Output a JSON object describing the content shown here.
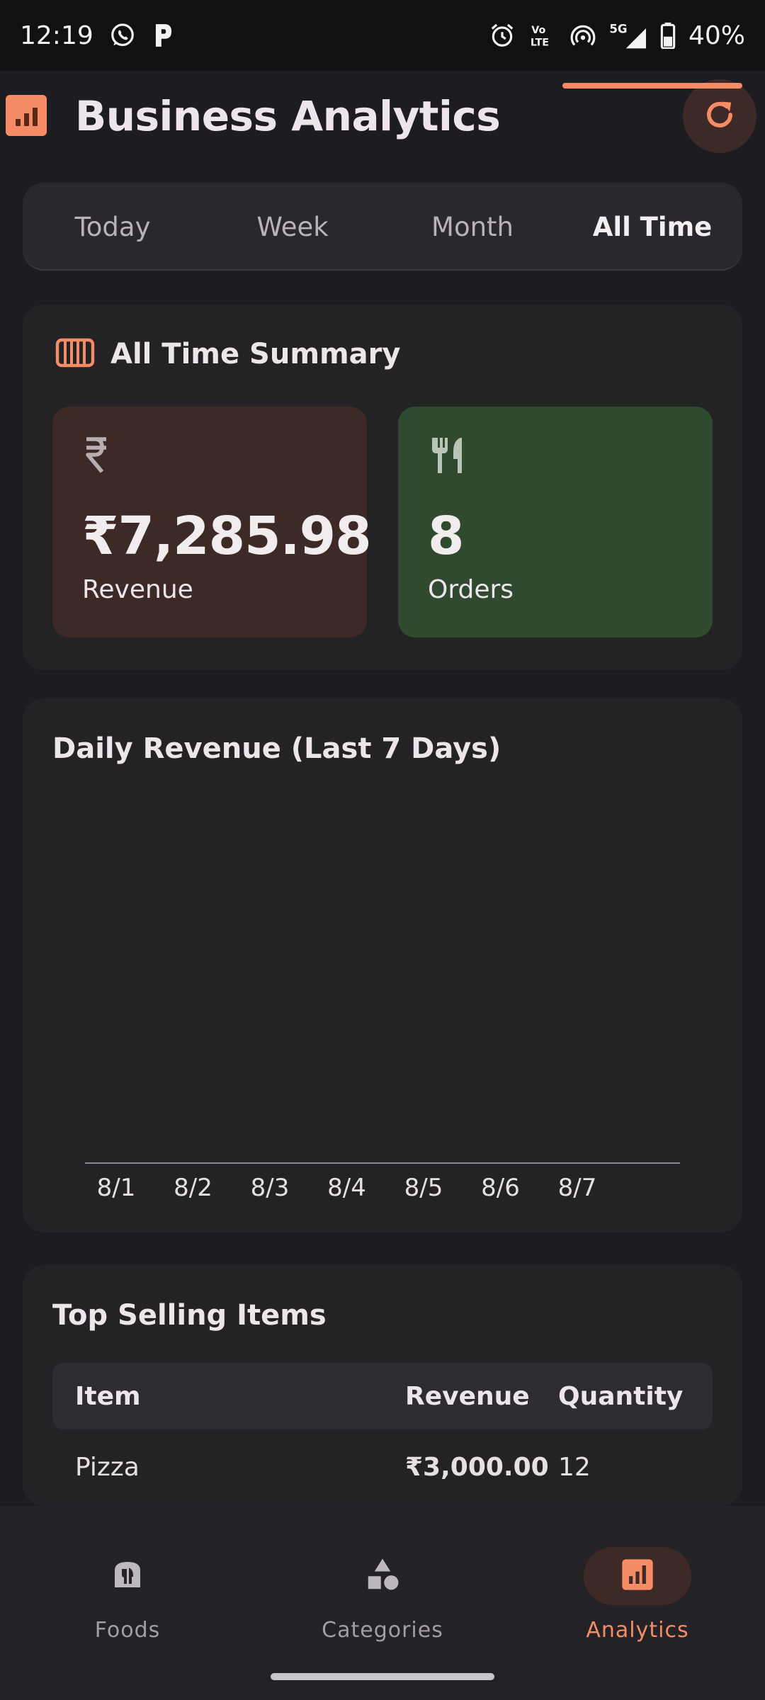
{
  "status_bar": {
    "time": "12:19",
    "battery": "40%",
    "network": "5G",
    "icons": [
      "whatsapp-icon",
      "parking-icon",
      "alarm-icon",
      "volte-icon",
      "hotspot-icon",
      "signal-icon",
      "battery-icon"
    ]
  },
  "app_bar": {
    "title": "Business Analytics",
    "logo_icon": "analytics-icon",
    "refresh_icon": "refresh-icon"
  },
  "tabs": [
    {
      "label": "Today",
      "active": false
    },
    {
      "label": "Week",
      "active": false
    },
    {
      "label": "Month",
      "active": false
    },
    {
      "label": "All Time",
      "active": true
    }
  ],
  "summary": {
    "title": "All Time Summary",
    "revenue": {
      "value": "₹7,285.98",
      "label": "Revenue",
      "icon": "rupee-icon"
    },
    "orders": {
      "value": "8",
      "label": "Orders",
      "icon": "cutlery-icon"
    }
  },
  "chart": {
    "title": "Daily Revenue (Last 7 Days)"
  },
  "chart_data": {
    "type": "bar",
    "title": "Daily Revenue (Last 7 Days)",
    "categories": [
      "8/1",
      "8/2",
      "8/3",
      "8/4",
      "8/5",
      "8/6",
      "8/7"
    ],
    "values": [
      0,
      0,
      0,
      0,
      0,
      0,
      0
    ],
    "xlabel": "",
    "ylabel": "",
    "grid": false
  },
  "top_items": {
    "title": "Top Selling Items",
    "headers": {
      "item": "Item",
      "revenue": "Revenue",
      "quantity": "Quantity"
    },
    "rows": [
      {
        "item": "Pizza",
        "revenue": "₹3,000.00",
        "quantity": "12"
      }
    ]
  },
  "bottom_nav": [
    {
      "label": "Foods",
      "icon": "food-icon",
      "active": false
    },
    {
      "label": "Categories",
      "icon": "categories-icon",
      "active": false
    },
    {
      "label": "Analytics",
      "icon": "analytics-icon",
      "active": true
    }
  ],
  "colors": {
    "accent": "#f58c66",
    "background": "#1d1d21",
    "card": "#232326",
    "revenue_card": "#3d2a27",
    "orders_card": "#2f4a2f"
  }
}
